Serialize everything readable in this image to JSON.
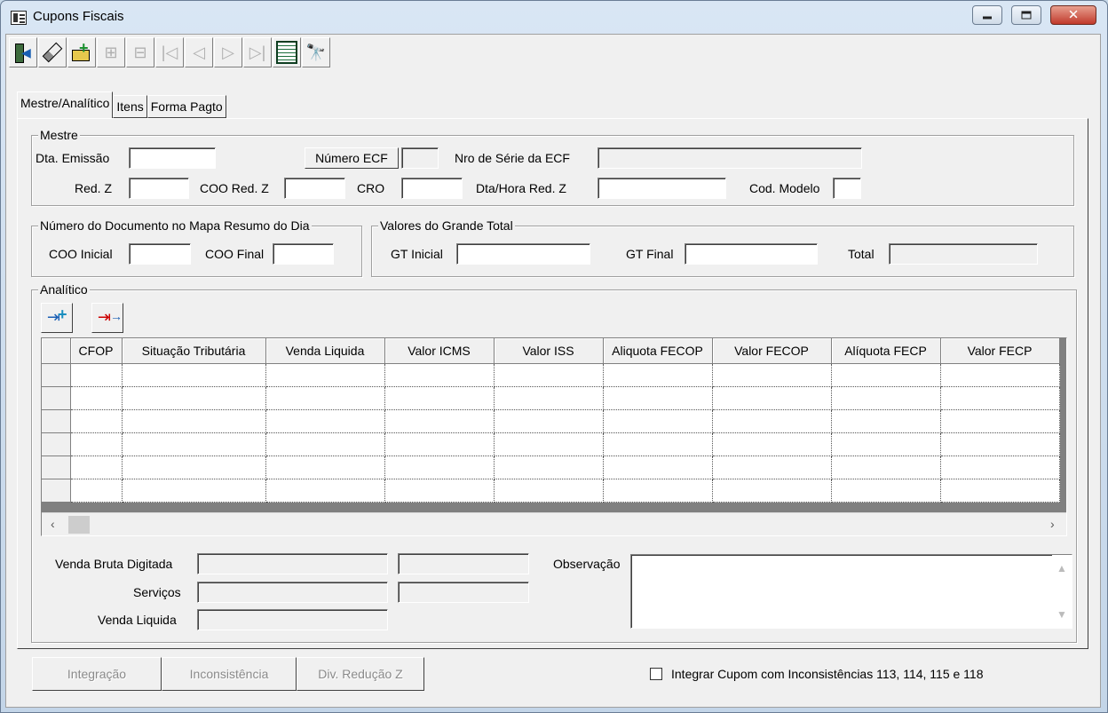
{
  "window": {
    "title": "Cupons Fiscais"
  },
  "tabs": [
    "Mestre/Analítico",
    "Itens",
    "Forma Pagto"
  ],
  "mestre": {
    "title": "Mestre",
    "dta_emissao": "Dta. Emissão",
    "numero_ecf_button": "Número ECF",
    "nro_serie": "Nro de Série da ECF",
    "red_z": "Red. Z",
    "coo_red_z": "COO Red. Z",
    "cro": "CRO",
    "dta_hora_red_z": "Dta/Hora Red. Z",
    "cod_modelo": "Cod. Modelo"
  },
  "documento": {
    "title": "Número do Documento no Mapa Resumo do Dia",
    "coo_inicial": "COO Inicial",
    "coo_final": "COO Final"
  },
  "grande_total": {
    "title": "Valores do Grande Total",
    "gt_inicial": "GT Inicial",
    "gt_final": "GT Final",
    "total": "Total"
  },
  "analitico": {
    "title": "Analítico",
    "columns": [
      "CFOP",
      "Situação Tributária",
      "Venda Liquida",
      "Valor ICMS",
      "Valor ISS",
      "Aliquota FECOP",
      "Valor FECOP",
      "Alíquota FECP",
      "Valor FECP"
    ]
  },
  "totais": {
    "venda_bruta": "Venda Bruta Digitada",
    "servicos": "Serviços",
    "venda_liquida": "Venda Liquida",
    "observacao": "Observação"
  },
  "bottom": {
    "integracao": "Integração",
    "inconsistencia": "Inconsistência",
    "div_reducao": "Div. Redução Z",
    "integrar_checkbox": "Integrar Cupom com Inconsistências 113, 114, 115 e 118"
  }
}
